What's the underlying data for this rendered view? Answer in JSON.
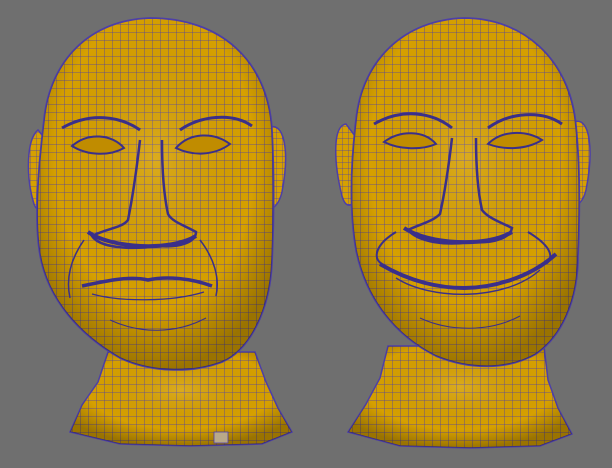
{
  "viewport": {
    "background_color": "#6f6f6f",
    "mesh_fill_color": "#d6a000",
    "mesh_wire_color": "#4d3fa8",
    "selected_face_color": "#b9a98a"
  },
  "models": [
    {
      "name": "neutral-expression-head-mesh",
      "expression": "neutral"
    },
    {
      "name": "smile-expression-head-mesh",
      "expression": "smile"
    }
  ]
}
